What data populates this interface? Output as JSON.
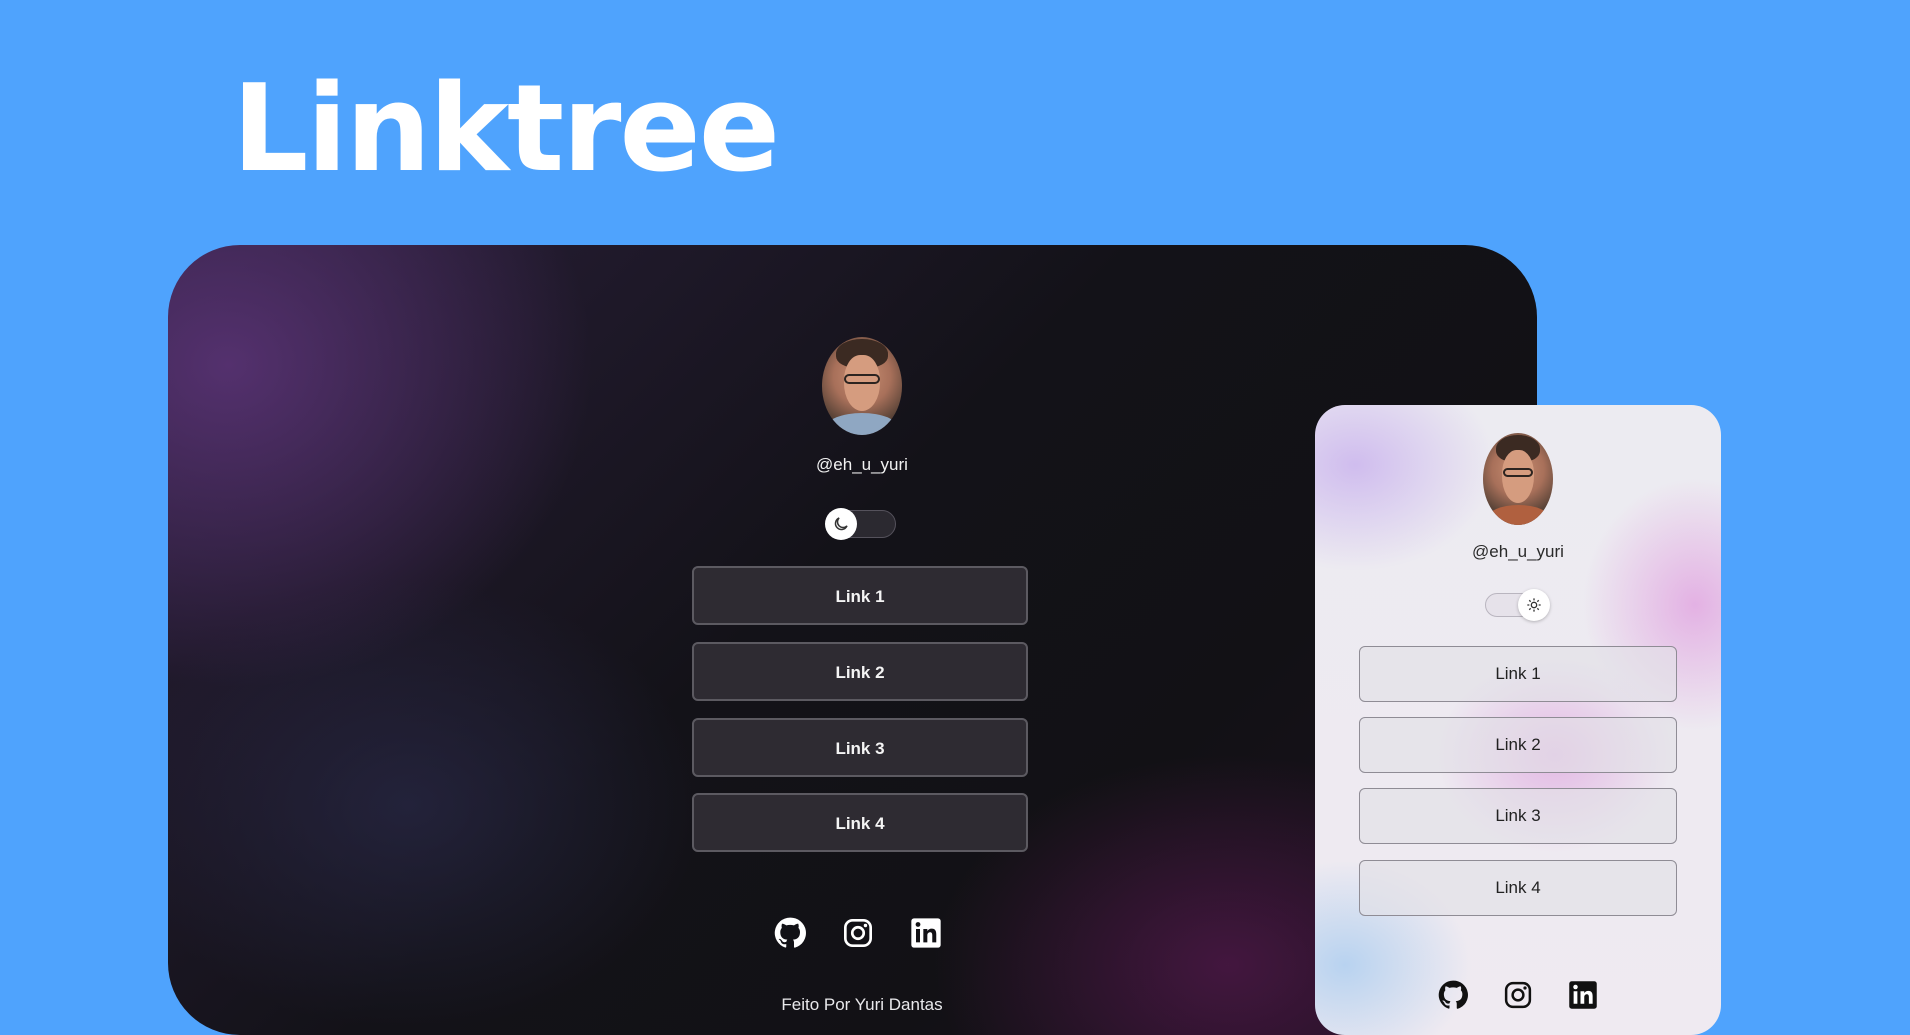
{
  "hero": {
    "title": "Linktree"
  },
  "dark_preview": {
    "username": "@eh_u_yuri",
    "toggle_icon": "moon-icon",
    "links": [
      "Link 1",
      "Link 2",
      "Link 3",
      "Link 4"
    ],
    "social": [
      "github-icon",
      "instagram-icon",
      "linkedin-icon"
    ],
    "footer": "Feito Por Yuri Dantas"
  },
  "light_preview": {
    "username": "@eh_u_yuri",
    "toggle_icon": "sun-icon",
    "links": [
      "Link 1",
      "Link 2",
      "Link 3",
      "Link 4"
    ],
    "social": [
      "github-icon",
      "instagram-icon",
      "linkedin-icon"
    ]
  },
  "colors": {
    "background": "#4fa3fd",
    "dark_button": "#2e2b32",
    "light_button": "#e2e0e6"
  }
}
